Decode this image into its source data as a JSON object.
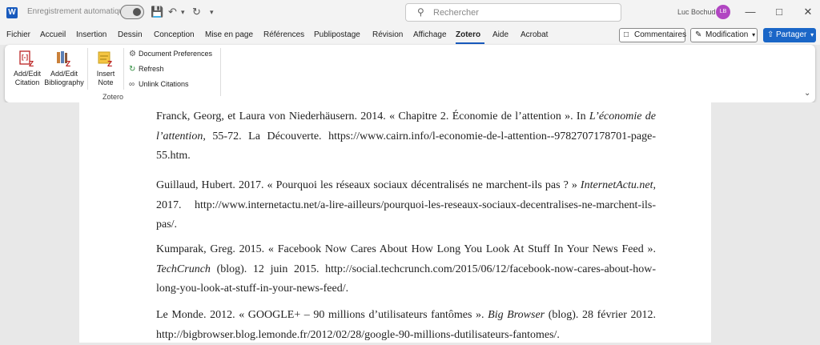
{
  "titlebar": {
    "app_icon_letter": "W",
    "autosave_label": "Enregistrement automatique",
    "search_placeholder": "Rechercher",
    "user_name": "Luc Bochud",
    "user_initials": "LB"
  },
  "menubar": {
    "items": [
      "Fichier",
      "Accueil",
      "Insertion",
      "Dessin",
      "Conception",
      "Mise en page",
      "Références",
      "Publipostage",
      "Révision",
      "Affichage",
      "Zotero",
      "Aide",
      "Acrobat"
    ],
    "comments_label": "Commentaires",
    "editing_label": "Modification",
    "share_label": "Partager"
  },
  "ribbon": {
    "add_edit_citation": [
      "Add/Edit",
      "Citation"
    ],
    "add_edit_bibliography": [
      "Add/Edit",
      "Bibliography"
    ],
    "insert_note": [
      "Insert",
      "Note"
    ],
    "document_preferences": "Document Preferences",
    "refresh": "Refresh",
    "unlink_citations": "Unlink Citations",
    "group_label": "Zotero"
  },
  "bibliography": [
    {
      "p1": "Franck, Georg, et Laura von Niederhäusern. 2014. « Chapitre 2. Économie de l’attention ». In ",
      "i1": "L’économie de l’attention",
      "p2": ", 55‑72. La Découverte. https://www.cairn.info/l-economie-de-l-attention--9782707178701-page-55.htm."
    },
    {
      "p1": "Guillaud, Hubert. 2017. « Pourquoi les réseaux sociaux décentralisés ne marchent-ils pas ? » ",
      "i1": "InternetActu.net",
      "p2": ", 2017. http://www.internetactu.net/a-lire-ailleurs/pourquoi-les-reseaux-sociaux-decentralises-ne-marchent-ils-pas/."
    },
    {
      "p1": "Kumparak, Greg. 2015. « Facebook Now Cares About How Long You Look At Stuff In Your News Feed ». ",
      "i1": "TechCrunch",
      "p2": " (blog). 12 juin 2015. http://social.techcrunch.com/2015/06/12/facebook-now-cares-about-how-long-you-look-at-stuff-in-your-news-feed/."
    },
    {
      "p1": "Le Monde. 2012. « GOOGLE+ – 90 millions d’utilisateurs fantômes ». ",
      "i1": "Big Browser",
      "p2": " (blog). 28 février 2012. http://bigbrowser.blog.lemonde.fr/2012/02/28/google-90-millions-dutilisateurs-fantomes/."
    }
  ],
  "colors": {
    "accent": "#185abd",
    "share": "#1a66c7",
    "avatar": "#b146c2"
  }
}
